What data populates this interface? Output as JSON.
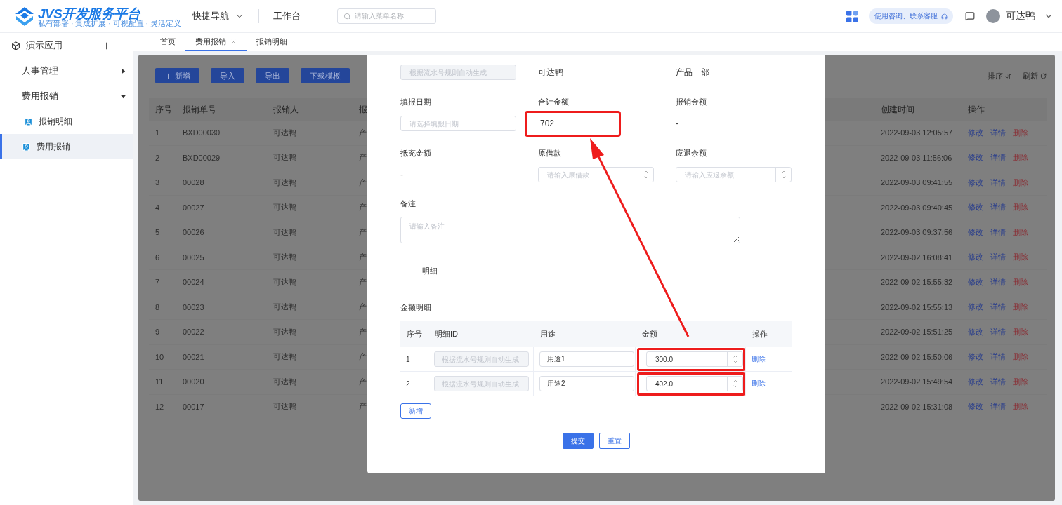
{
  "header": {
    "logo": {
      "title": "JVS开发服务平台",
      "tagline": "私有部署 · 集成扩展 · 可视配置 · 灵活定义"
    },
    "nav": [
      {
        "label": "快捷导航",
        "kind": "dropdown"
      },
      {
        "label": "工作台",
        "kind": "link"
      }
    ],
    "search": {
      "placeholder": "请输入菜单名称"
    },
    "support": "使用咨询、联系客服",
    "user": "可达鸭"
  },
  "sidebar": {
    "app": "演示应用",
    "items": [
      {
        "label": "人事管理",
        "expanded": false
      },
      {
        "label": "费用报销",
        "expanded": true,
        "children": [
          {
            "label": "报销明细",
            "selected": false
          },
          {
            "label": "费用报销",
            "selected": true
          }
        ]
      }
    ]
  },
  "tabs": [
    {
      "label": "首页",
      "selected": false,
      "closable": false
    },
    {
      "label": "费用报销",
      "selected": true,
      "closable": true
    },
    {
      "label": "报销明细",
      "selected": false,
      "closable": false
    }
  ],
  "list": {
    "buttons": [
      {
        "label": "新增",
        "kind": "add"
      },
      {
        "label": "导入",
        "kind": "plain"
      },
      {
        "label": "导出",
        "kind": "plain"
      },
      {
        "label": "下载模板",
        "kind": "plain"
      }
    ],
    "tools": [
      {
        "label": "排序",
        "kind": "sort"
      },
      {
        "label": "刷新",
        "kind": "refresh"
      }
    ],
    "columns": [
      "序号",
      "报销单号",
      "报销人",
      "报",
      "创建时间",
      "操作"
    ],
    "rows": [
      {
        "index": "1",
        "number": "BXD00030",
        "person": "可达鸭",
        "column_4": "产",
        "created": "2022-09-03 12:05:57",
        "actions": [
          "修改",
          "详情",
          "删除"
        ]
      },
      {
        "index": "2",
        "number": "BXD00029",
        "person": "可达鸭",
        "column_4": "产",
        "created": "2022-09-03 11:56:06",
        "actions": [
          "修改",
          "详情",
          "删除"
        ]
      },
      {
        "index": "3",
        "number": "00028",
        "person": "可达鸭",
        "column_4": "产",
        "created": "2022-09-03 09:41:55",
        "actions": [
          "修改",
          "详情",
          "删除"
        ]
      },
      {
        "index": "4",
        "number": "00027",
        "person": "可达鸭",
        "column_4": "产",
        "created": "2022-09-03 09:40:45",
        "actions": [
          "修改",
          "详情",
          "删除"
        ]
      },
      {
        "index": "5",
        "number": "00026",
        "person": "可达鸭",
        "column_4": "产",
        "created": "2022-09-03 09:37:56",
        "actions": [
          "修改",
          "详情",
          "删除"
        ]
      },
      {
        "index": "6",
        "number": "00025",
        "person": "可达鸭",
        "column_4": "产",
        "created": "2022-09-02 16:08:41",
        "actions": [
          "修改",
          "详情",
          "删除"
        ]
      },
      {
        "index": "7",
        "number": "00024",
        "person": "可达鸭",
        "column_4": "产",
        "created": "2022-09-02 15:55:32",
        "actions": [
          "修改",
          "详情",
          "删除"
        ]
      },
      {
        "index": "8",
        "number": "00023",
        "person": "可达鸭",
        "column_4": "产",
        "created": "2022-09-02 15:55:13",
        "actions": [
          "修改",
          "详情",
          "删除"
        ]
      },
      {
        "index": "9",
        "number": "00022",
        "person": "可达鸭",
        "column_4": "产",
        "created": "2022-09-02 15:51:25",
        "actions": [
          "修改",
          "详情",
          "删除"
        ]
      },
      {
        "index": "10",
        "number": "00021",
        "person": "可达鸭",
        "column_4": "产",
        "created": "2022-09-02 15:50:06",
        "actions": [
          "修改",
          "详情",
          "删除"
        ]
      },
      {
        "index": "11",
        "number": "00020",
        "person": "可达鸭",
        "column_4": "产",
        "created": "2022-09-02 15:49:54",
        "actions": [
          "修改",
          "详情",
          "删除"
        ]
      },
      {
        "index": "12",
        "number": "00017",
        "person": "可达鸭",
        "column_4": "产",
        "created": "2022-09-02 15:31:08",
        "actions": [
          "修改",
          "详情",
          "删除"
        ]
      }
    ]
  },
  "form": {
    "fields": [
      {
        "kind": "input",
        "placeholder": "根据流水号规则自动生成",
        "disabled": true,
        "highlighted": false
      },
      {
        "kind": "text",
        "value": "可达鸭",
        "highlighted": false
      },
      {
        "kind": "text",
        "value": "产品一部",
        "highlighted": false
      },
      {
        "kind": "input",
        "label": "填报日期",
        "placeholder": "请选择填报日期",
        "disabled": false,
        "highlighted": false
      },
      {
        "kind": "text",
        "label": "合计金额",
        "value": "702",
        "highlighted": true
      },
      {
        "kind": "text",
        "label": "报销金额",
        "value": "-",
        "highlighted": false
      },
      {
        "kind": "text",
        "label": "抵充金额",
        "value": "-",
        "highlighted": false
      },
      {
        "kind": "number",
        "label": "原借款",
        "placeholder": "请输入原借款",
        "highlighted": false
      },
      {
        "kind": "number",
        "label": "应退余额",
        "placeholder": "请输入应退余额",
        "highlighted": false
      }
    ],
    "remark": {
      "label": "备注",
      "placeholder": "请输入备注"
    },
    "section": "明细",
    "detail": {
      "title": "金额明细",
      "columns": [
        "序号",
        "明细ID",
        "用途",
        "金额",
        "操作"
      ],
      "rows": [
        {
          "index": "1",
          "id_placeholder": "根据流水号规则自动生成",
          "purpose": "用途1",
          "amount": "300.0",
          "action": "删除",
          "highlighted": true
        },
        {
          "index": "2",
          "id_placeholder": "根据流水号规则自动生成",
          "purpose": "用途2",
          "amount": "402.0",
          "action": "删除",
          "highlighted": true
        }
      ],
      "add": "新增"
    },
    "actions": [
      {
        "label": "提交",
        "kind": "primary"
      },
      {
        "label": "重置",
        "kind": "default"
      }
    ]
  }
}
